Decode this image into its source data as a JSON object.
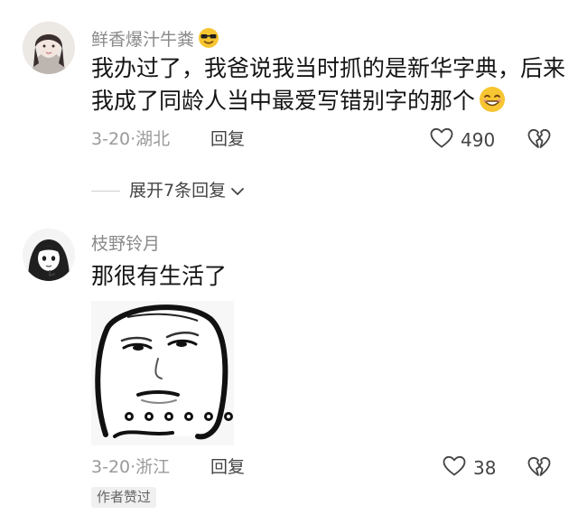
{
  "comments": [
    {
      "username": "鲜香爆汁牛粪",
      "username_emoji": "sunglasses-emoji",
      "text_lines": [
        "我办过了，我爸说我当时抓的是新华字典，后来",
        "我成了同龄人当中最爱写错别字的那个"
      ],
      "text_emoji": "grinning-emoji",
      "date": "3-20",
      "location": "湖北",
      "reply_label": "回复",
      "like_count": "490",
      "expand_label": "展开7条回复"
    },
    {
      "username": "枝野铃月",
      "text": "那很有生活了",
      "sticker": "meme-face-sticker",
      "date": "3-20",
      "location": "浙江",
      "reply_label": "回复",
      "like_count": "38",
      "badge": "作者赞过"
    }
  ],
  "colors": {
    "text": "#151515",
    "meta": "#9a9a9a",
    "action": "#444444",
    "emoji": "#f7c531"
  }
}
